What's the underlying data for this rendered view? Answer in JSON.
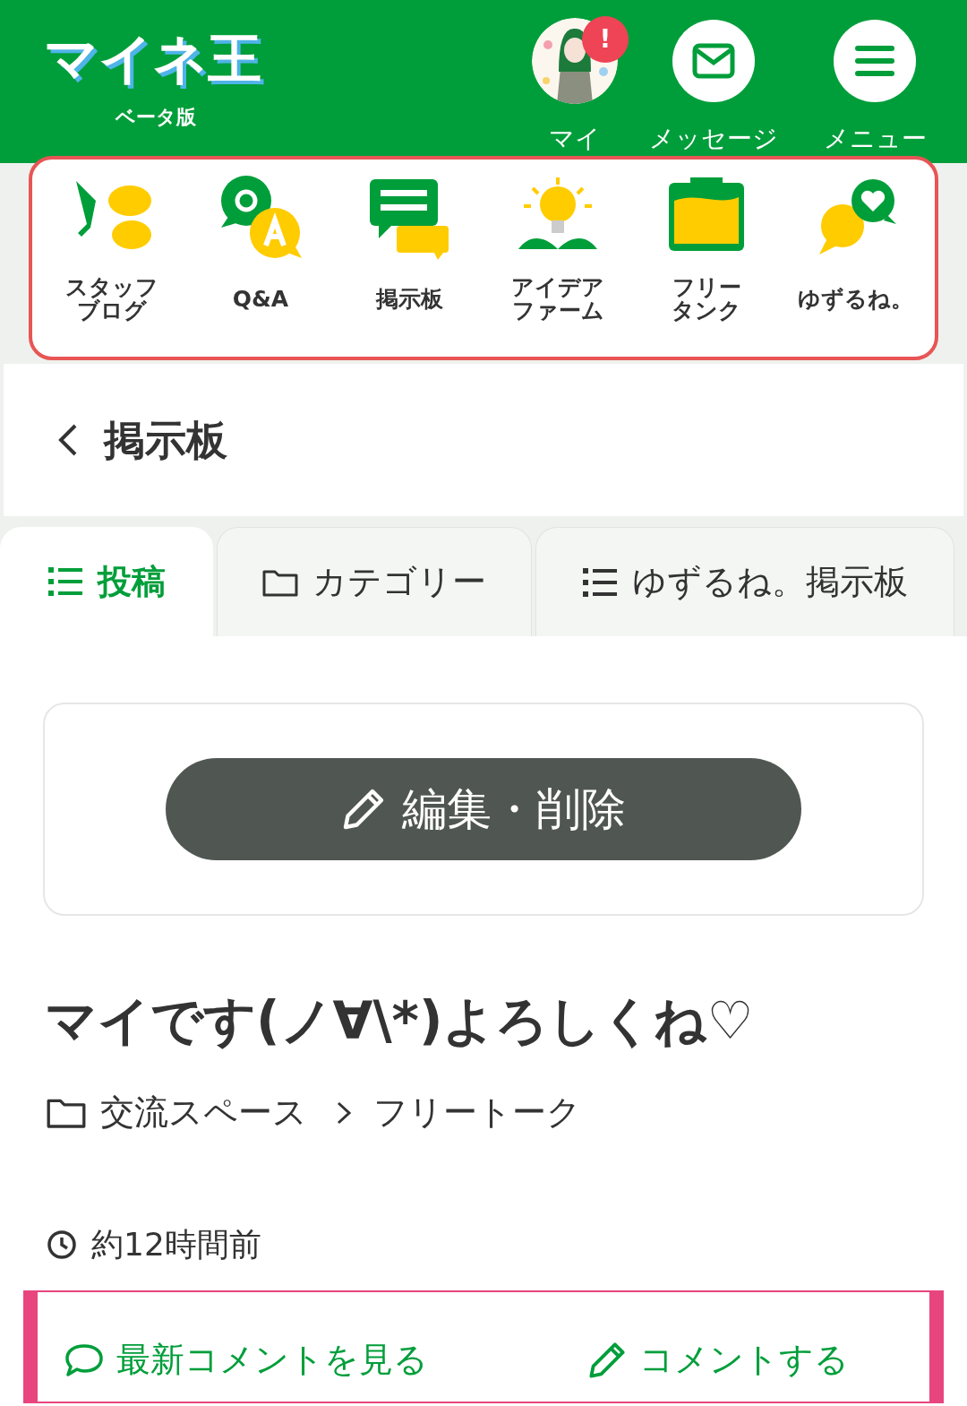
{
  "header": {
    "logo": "マイネ王",
    "logo_sub": "ベータ版",
    "actions": [
      {
        "kind": "avatar",
        "label": "マイ",
        "badge": "!"
      },
      {
        "kind": "mail",
        "label": "メッセージ"
      },
      {
        "kind": "menu",
        "label": "メニュー"
      }
    ]
  },
  "nav": [
    {
      "label": "スタッフブログ"
    },
    {
      "label": "Q&A"
    },
    {
      "label": "掲示板"
    },
    {
      "label": "アイデアファーム"
    },
    {
      "label": "フリータンク"
    },
    {
      "label": "ゆずるね。"
    }
  ],
  "page_title": "掲示板",
  "tabs": [
    {
      "kind": "list",
      "label": "投稿",
      "selected": true
    },
    {
      "kind": "folder",
      "label": "カテゴリー",
      "selected": false
    },
    {
      "kind": "list",
      "label": "ゆずるね。掲示板",
      "selected": false
    }
  ],
  "edit_button": "編集・削除",
  "post": {
    "title": "マイです(ノ∀\\*)よろしくね♡",
    "breadcrumb": [
      "交流スペース",
      "フリートーク"
    ],
    "time": "約12時間前"
  },
  "actions": [
    {
      "kind": "view",
      "label": "最新コメントを見る"
    },
    {
      "kind": "comment",
      "label": "コメントする"
    }
  ]
}
